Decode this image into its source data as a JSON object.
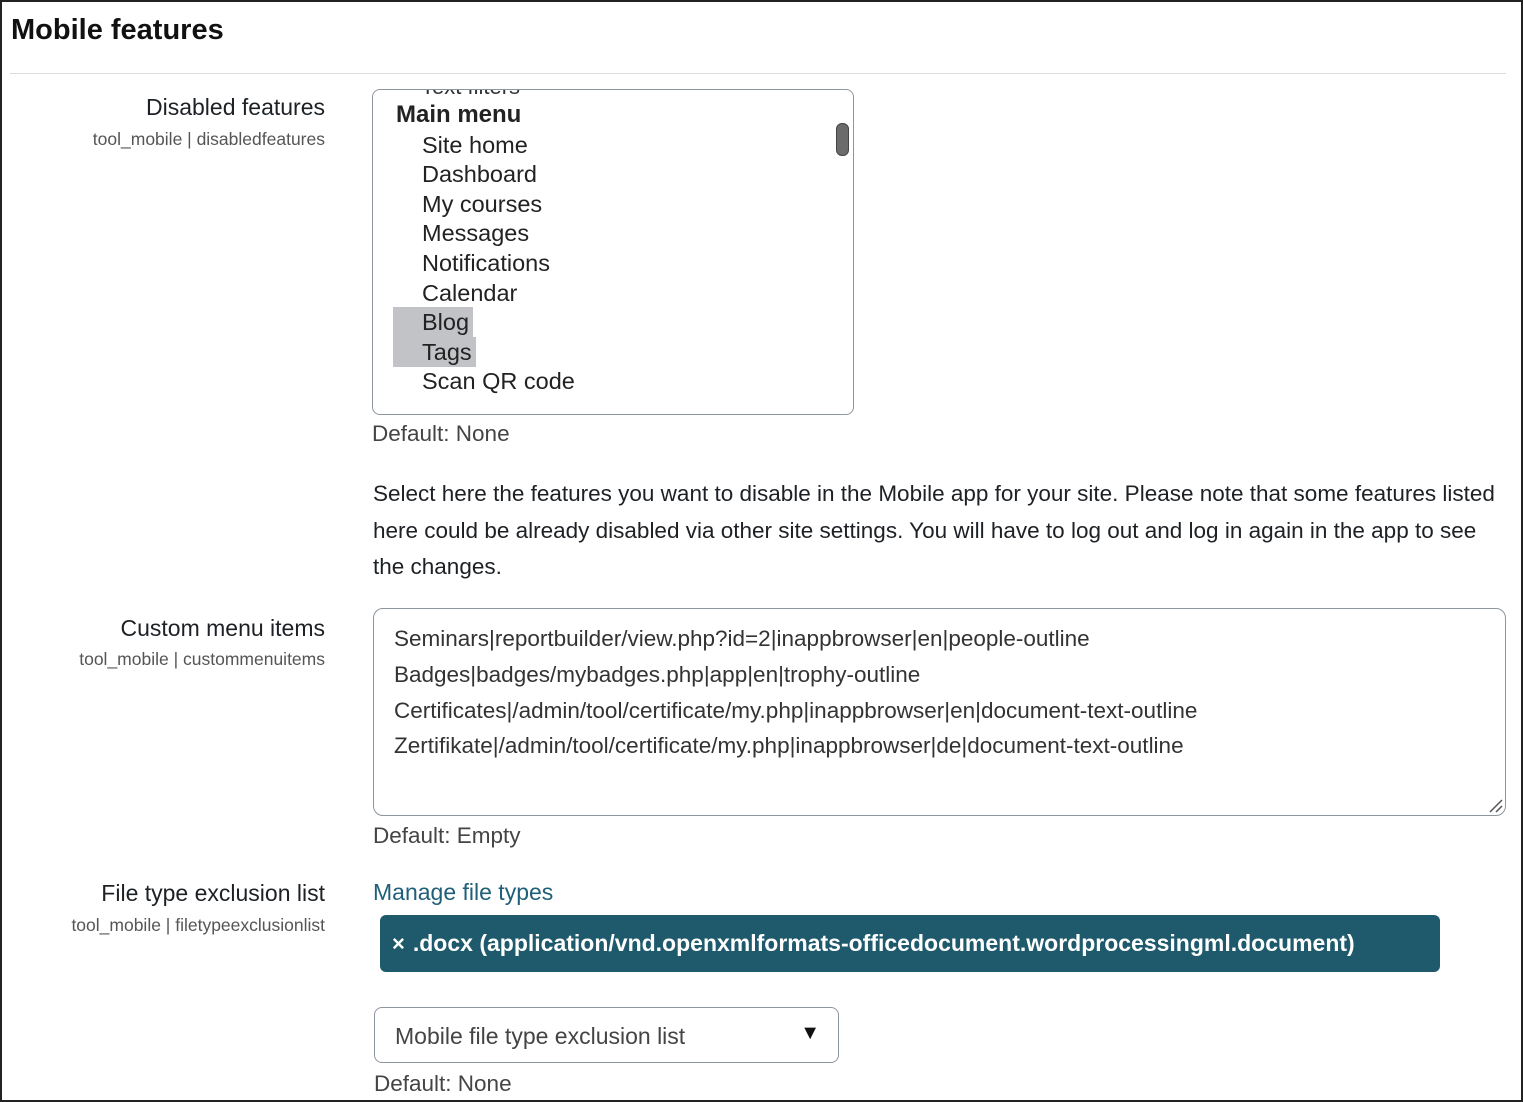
{
  "page": {
    "title": "Mobile features"
  },
  "disabled_features": {
    "label": "Disabled features",
    "sublabel": "tool_mobile | disabledfeatures",
    "clipped_option": "Text filters",
    "group_label": "Main menu",
    "options": [
      {
        "label": "Site home",
        "selected": false
      },
      {
        "label": "Dashboard",
        "selected": false
      },
      {
        "label": "My courses",
        "selected": false
      },
      {
        "label": "Messages",
        "selected": false
      },
      {
        "label": "Notifications",
        "selected": false
      },
      {
        "label": "Calendar",
        "selected": false
      },
      {
        "label": "Blog",
        "selected": true
      },
      {
        "label": "Tags",
        "selected": true
      },
      {
        "label": "Scan QR code",
        "selected": false
      }
    ],
    "default": "Default: None",
    "description": "Select here the features you want to disable in the Mobile app for your site. Please note that some features listed here could be already disabled via other site settings. You will have to log out and log in again in the app to see the changes."
  },
  "custom_menu_items": {
    "label": "Custom menu items",
    "sublabel": "tool_mobile | custommenuitems",
    "lines": [
      "Seminars|reportbuilder/view.php?id=2|inappbrowser|en|people-outline",
      "Badges|badges/mybadges.php|app|en|trophy-outline",
      "Certificates|/admin/tool/certificate/my.php|inappbrowser|en|document-text-outline",
      "Zertifikate|/admin/tool/certificate/my.php|inappbrowser|de|document-text-outline"
    ],
    "default": "Default: Empty"
  },
  "file_type_exclusion": {
    "label": "File type exclusion list",
    "sublabel": "tool_mobile | filetypeexclusionlist",
    "manage_link": "Manage file types",
    "chip_remove": "×",
    "chip_label": ".docx (application/vnd.openxmlformats-officedocument.wordprocessingml.document)",
    "select_placeholder": "Mobile file type exclusion list",
    "default": "Default: None"
  },
  "icons": {
    "chip_remove": "close-icon",
    "select_caret": "caret-down-icon",
    "textarea_resize": "resize-handle-icon"
  },
  "colors": {
    "chip_bg": "#1e5a6b",
    "link": "#1f5f78",
    "selected_option": "#c1c3c7"
  }
}
